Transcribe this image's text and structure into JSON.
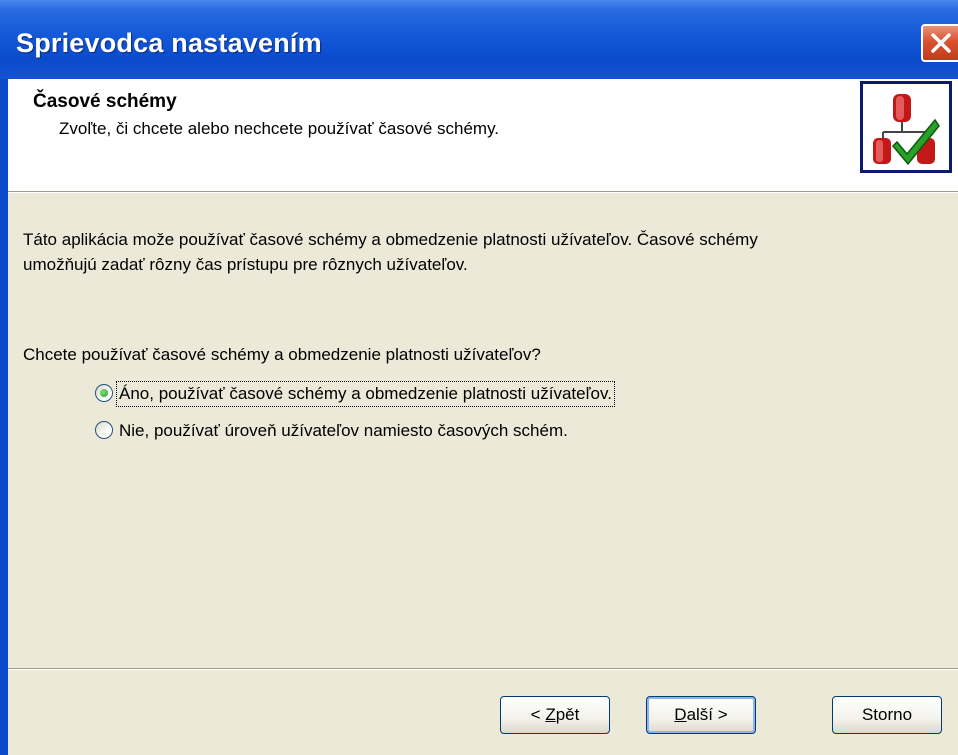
{
  "window": {
    "title": "Sprievodca nastavením"
  },
  "header": {
    "title": "Časové schémy",
    "subtitle": "Zvoľte, či chcete alebo nechcete používať časové schémy."
  },
  "body": {
    "intro_line1": "Táto aplikácia može používať časové schémy a obmedzenie platnosti užívateľov. Časové schémy",
    "intro_line2": "umožňujú zadať rôzny čas prístupu pre rôznych užívateľov.",
    "question": "Chcete používať časové schémy a obmedzenie platnosti užívateľov?",
    "options": [
      {
        "label": "Áno, používať časové schémy a obmedzenie platnosti užívateľov.",
        "selected": true
      },
      {
        "label": "Nie, používať úroveň užívateľov namiesto časových schém.",
        "selected": false
      }
    ]
  },
  "buttons": {
    "back": {
      "prefix": "< ",
      "accel": "Z",
      "rest": "pět"
    },
    "next": {
      "accel": "D",
      "rest": "alší >"
    },
    "cancel": {
      "label": "Storno"
    }
  },
  "colors": {
    "titlebar": "#0a4bcc",
    "close": "#d9532f",
    "dialog_bg": "#ece9d8",
    "radio_selected": "#21a121"
  },
  "icons": {
    "close": "close-x-icon",
    "wizard_logo": "server-check-icon"
  }
}
